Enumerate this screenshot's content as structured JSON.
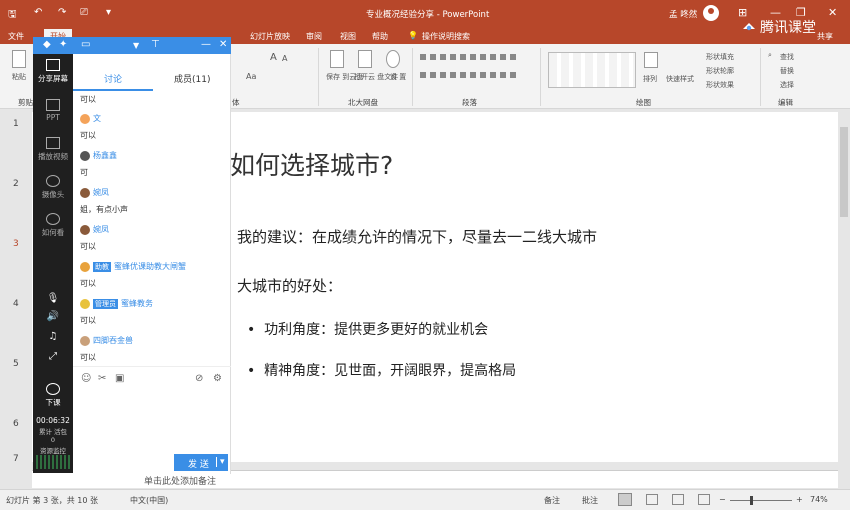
{
  "window": {
    "title": "专业概况经验分享 - PowerPoint",
    "user": "孟 咚然",
    "brand": "腾讯课堂",
    "share_label": "共享",
    "min": "—",
    "restore": "❐",
    "close": "✕",
    "ribbon_display": "⊞"
  },
  "qat": {
    "save": "🖫",
    "undo": "↶",
    "redo": "↷",
    "present": "⎚",
    "more": "▾"
  },
  "menu": {
    "file": "文件",
    "home": "开始",
    "slideshow": "幻灯片放映",
    "review": "审阅",
    "view": "视图",
    "help": "帮助",
    "tellme": "操作说明搜索"
  },
  "ribbon": {
    "paste": "粘贴",
    "clipboard": "剪贴",
    "font_group": "体",
    "save_cloud": "保存\n到云盘",
    "open_cloud": "打开云\n盘文件",
    "settings": "设\n置",
    "cloud_group": "北大网盘",
    "paragraph_group": "段落",
    "arrange": "排列",
    "quick_styles": "快速样式",
    "shape_fill": "形状填充",
    "shape_outline": "形状轮廓",
    "shape_effects": "形状效果",
    "drawing_group": "绘图",
    "find": "查找",
    "replace": "替换",
    "select": "选择",
    "editing_group": "编辑",
    "font_size_a": "A",
    "font_a": "Aa"
  },
  "overlay": {
    "tabs": {
      "discussion": "讨论",
      "members": "成员(11)"
    },
    "side": {
      "share_screen": "分享屏幕",
      "ppt": "PPT",
      "play_video": "播放视频",
      "camera": "摄像头",
      "raise_hand": "如何看",
      "end_class": "下课",
      "timer": "00:06:32",
      "stats": "累计 活包\n0",
      "resources": "资源监控"
    },
    "messages": [
      {
        "name": "",
        "text": "可以"
      },
      {
        "name": "文",
        "text": "可以"
      },
      {
        "name": "杨鑫鑫",
        "text": "可"
      },
      {
        "name": "婉凤",
        "text": "姐，有点小声"
      },
      {
        "name": "婉凤",
        "text": "可以"
      },
      {
        "tag": "助教",
        "name": "蜜蜂优课助教大闸蟹",
        "text": "可以"
      },
      {
        "tag": "管理员",
        "name": "蜜蜂教务",
        "text": "可以"
      },
      {
        "name": "四脚吞金兽",
        "text": "可以"
      }
    ],
    "send": "发 送",
    "send_arrow": "▾"
  },
  "slide": {
    "title": "如何选择城市?",
    "p1": "我的建议：在成绩允许的情况下，尽量去一二线大城市",
    "p2": "大城市的好处：",
    "b1": "功利角度：提供更多更好的就业机会",
    "b2": "精神角度：见世面，开阔眼界，提高格局"
  },
  "slide_numbers": [
    "1",
    "2",
    "3",
    "4",
    "5",
    "6",
    "7"
  ],
  "notes_placeholder": "单击此处添加备注",
  "status": {
    "slide_info": "幻灯片 第 3 张，共 10 张",
    "language": "中文(中国)",
    "notes": "备注",
    "comments": "批注",
    "zoom": "74%",
    "zoom_minus": "−",
    "zoom_plus": "+"
  },
  "colors": {
    "accent": "#b7472a",
    "overlay_blue": "#3a8ee6",
    "overlay_dark": "#1f1f1f"
  }
}
